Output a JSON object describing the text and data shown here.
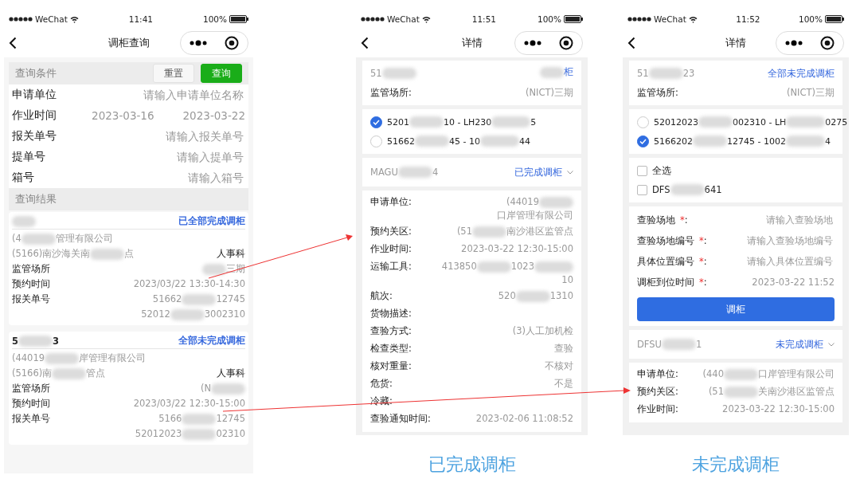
{
  "screens": [
    {
      "kind": "query",
      "status_bar": {
        "carrier": "WeChat",
        "time": "11:41",
        "battery": "100%"
      },
      "title": "调柜查询",
      "conditions": {
        "heading": "查询条件",
        "reset": "重置",
        "search": "查询",
        "fields": [
          {
            "kind": "text",
            "label": "申请单位",
            "placeholder": "请输入申请单位名称"
          },
          {
            "kind": "date_range",
            "label": "作业时间",
            "start": "2023-03-16",
            "end": "2023-03-22"
          },
          {
            "kind": "text",
            "label": "报关单号",
            "placeholder": "请输入报关单号"
          },
          {
            "kind": "text",
            "label": "提单号",
            "placeholder": "请输入提单号"
          },
          {
            "kind": "text",
            "label": "箱号",
            "placeholder": "请输入箱号"
          }
        ]
      },
      "results": {
        "heading": "查询结果",
        "cards": [
          {
            "number": [
              {
                "kind": "blur"
              }
            ],
            "status": "已全部完成调柜",
            "company": [
              "(4",
              {
                "kind": "blur"
              },
              "管理有限公司"
            ],
            "customs": [
              "(5166)南沙海关南",
              {
                "kind": "blur"
              },
              "点"
            ],
            "department": "人事科",
            "rows": [
              {
                "label": "监管场所",
                "values": [
                  [
                    {
                      "kind": "blur"
                    },
                    "三期"
                  ]
                ]
              },
              {
                "label": "预约时间",
                "values": [
                  [
                    "2023/03/22 13:30-14:30"
                  ]
                ]
              },
              {
                "label": "报关单号",
                "values": [
                  [
                    "51662",
                    {
                      "kind": "blur"
                    },
                    "12745"
                  ],
                  [
                    "52012",
                    {
                      "kind": "blur"
                    },
                    "3002310"
                  ]
                ]
              }
            ]
          },
          {
            "number": [
              "5",
              {
                "kind": "blur"
              },
              "3"
            ],
            "status": "全部未完成调柜",
            "company": [
              "(44019",
              {
                "kind": "blur"
              },
              "岸管理有限公司"
            ],
            "customs": [
              "(5166)南",
              {
                "kind": "blur"
              },
              "管点"
            ],
            "department": "人事科",
            "rows": [
              {
                "label": "监管场所",
                "values": [
                  [
                    "(N",
                    {
                      "kind": "blur"
                    }
                  ]
                ]
              },
              {
                "label": "预约时间",
                "values": [
                  [
                    "2023/03/22 12:30-15:00"
                  ]
                ]
              },
              {
                "label": "报关单号",
                "values": [
                  [
                    "5166",
                    {
                      "kind": "blur"
                    },
                    "12745"
                  ],
                  [
                    "52012023",
                    {
                      "kind": "blur"
                    },
                    "02310"
                  ]
                ]
              }
            ]
          }
        ]
      }
    },
    {
      "kind": "detail",
      "status_bar": {
        "carrier": "WeChat",
        "time": "11:51",
        "battery": "100%"
      },
      "title": "详情",
      "caption": "已完成调柜",
      "sections": [
        {
          "kind": "header",
          "number": [
            "51",
            {
              "kind": "blur"
            }
          ],
          "status": [
            {
              "kind": "blur"
            },
            "柜"
          ],
          "place_label": "监管场所:",
          "place": "(NICT)三期"
        },
        {
          "kind": "declarations",
          "items": [
            {
              "selected": true,
              "text": [
                "5201",
                {
                  "kind": "blur"
                },
                "10 - LH230",
                {
                  "kind": "blur"
                },
                "5"
              ]
            },
            {
              "selected": false,
              "text": [
                "51662",
                {
                  "kind": "blur"
                },
                "45 - 10",
                {
                  "kind": "blur"
                },
                "44"
              ]
            }
          ]
        },
        {
          "kind": "container",
          "id": [
            "MAGU",
            {
              "kind": "blur"
            },
            "4"
          ],
          "status": "已完成调柜"
        },
        {
          "kind": "info",
          "rows": [
            {
              "label": "申请单位:",
              "value": [
                "(44019",
                {
                  "kind": "blur"
                },
                "口岸管理有限公司"
              ]
            },
            {
              "label": "预约关区:",
              "value": [
                "(51",
                {
                  "kind": "blur"
                },
                "南沙港区监管点"
              ]
            },
            {
              "label": "作业时间:",
              "value": [
                "2023-03-22 12:30-15:00"
              ]
            },
            {
              "label": "运输工具:",
              "value": [
                "413850",
                {
                  "kind": "blur"
                },
                "1023",
                {
                  "kind": "blur"
                },
                "10"
              ]
            },
            {
              "label": "航次:",
              "value": [
                "520",
                {
                  "kind": "blur"
                },
                "1310"
              ]
            },
            {
              "label": "货物描述:"
            },
            {
              "label": "查验方式:",
              "value": [
                "(3)人工加机检"
              ]
            },
            {
              "label": "检查类型:",
              "value": [
                "查验"
              ]
            },
            {
              "label": "核对重量:",
              "value": [
                "不核对"
              ]
            },
            {
              "label": "危货:",
              "value": [
                "不是"
              ]
            },
            {
              "label": "冷藏:"
            },
            {
              "label": "查验通知时间:",
              "value": [
                "2023-02-06 11:08:52"
              ]
            }
          ]
        }
      ]
    },
    {
      "kind": "detail",
      "status_bar": {
        "carrier": "WeChat",
        "time": "11:52",
        "battery": "100%"
      },
      "title": "详情",
      "caption": "未完成调柜",
      "sections": [
        {
          "kind": "header",
          "number": [
            "51",
            {
              "kind": "blur"
            },
            "23"
          ],
          "status": [
            "全部未完成调柜"
          ],
          "place_label": "监管场所:",
          "place": "(NICT)三期"
        },
        {
          "kind": "declarations",
          "items": [
            {
              "selected": false,
              "text": [
                "52012023",
                {
                  "kind": "blur"
                },
                "002310 - LH",
                {
                  "kind": "blur"
                },
                "0275"
              ]
            },
            {
              "selected": true,
              "text": [
                "5166202",
                {
                  "kind": "blur"
                },
                "12745 - 1002",
                {
                  "kind": "blur"
                },
                "4"
              ]
            }
          ]
        },
        {
          "kind": "checkboxes",
          "items": [
            {
              "checked": false,
              "text": [
                "全选"
              ]
            },
            {
              "checked": false,
              "text": [
                "DFS",
                {
                  "kind": "blur"
                },
                "641"
              ]
            }
          ]
        },
        {
          "kind": "form",
          "button": "调柜",
          "fields": [
            {
              "label": "查验场地",
              "required_mark": "*",
              "colon": ":",
              "placeholder": "请输入查验场地"
            },
            {
              "label": "查验场地编号",
              "required_mark": "*",
              "colon": ":",
              "placeholder": "请输入查验场地编号"
            },
            {
              "label": "具体位置编号",
              "required_mark": "*",
              "colon": ":",
              "placeholder": "请输入具体位置编号"
            },
            {
              "label": "调柜到位时间",
              "required_mark": "*",
              "colon": ":",
              "value": "2023-03-22  11:52"
            }
          ]
        },
        {
          "kind": "container",
          "id": [
            "DFSU",
            {
              "kind": "blur"
            },
            "1"
          ],
          "status": "未完成调柜"
        },
        {
          "kind": "info",
          "rows": [
            {
              "label": "申请单位:",
              "value": [
                "(440",
                {
                  "kind": "blur"
                },
                "口岸管理有限公司"
              ]
            },
            {
              "label": "预约关区:",
              "value": [
                "(51",
                {
                  "kind": "blur"
                },
                "关南沙港区监管点"
              ]
            },
            {
              "label": "作业时间:",
              "value": [
                "2023-03-22 12:30-15:00"
              ]
            }
          ]
        }
      ]
    }
  ]
}
